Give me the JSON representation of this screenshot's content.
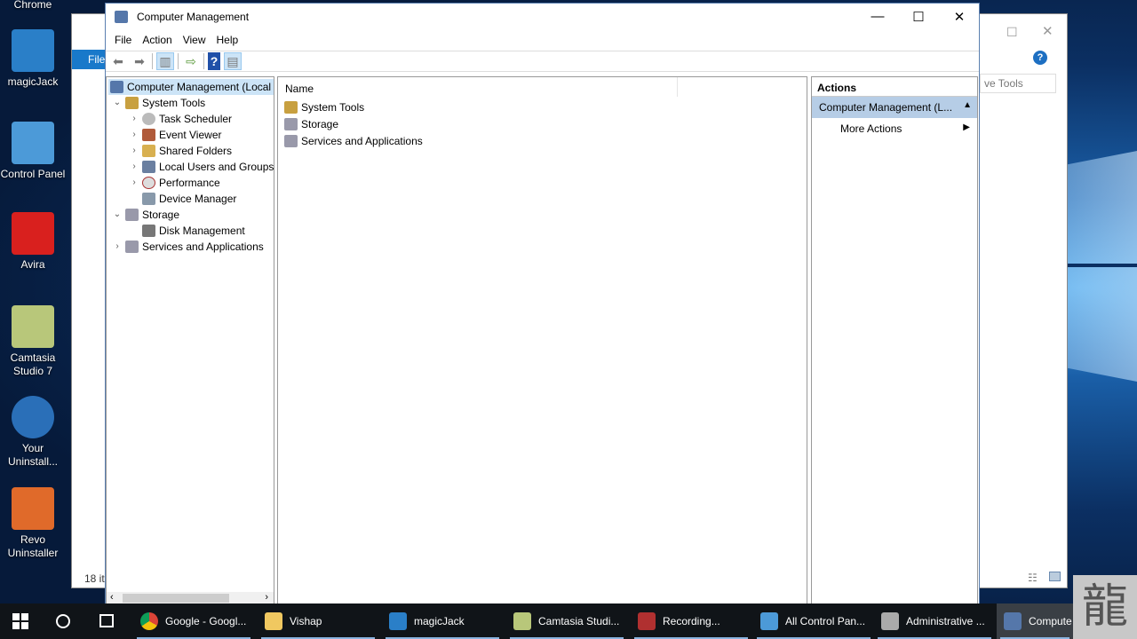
{
  "desktop": {
    "icons": [
      {
        "label": "Chrome"
      },
      {
        "label": "magicJack"
      },
      {
        "label": "Control Panel"
      },
      {
        "label": "Avira"
      },
      {
        "label": "Camtasia Studio 7"
      },
      {
        "label": "Your Uninstall..."
      },
      {
        "label": "Revo Uninstaller"
      }
    ]
  },
  "bg_window": {
    "ribbon_tab": "File",
    "search_placeholder": "ve Tools",
    "status": "18 it"
  },
  "window": {
    "title": "Computer Management",
    "controls": {
      "minimize": "—",
      "maximize": "☐",
      "close": "✕"
    }
  },
  "menu": [
    "File",
    "Action",
    "View",
    "Help"
  ],
  "tree": {
    "root": "Computer Management (Local",
    "items": [
      {
        "label": "System Tools"
      },
      {
        "label": "Task Scheduler"
      },
      {
        "label": "Event Viewer"
      },
      {
        "label": "Shared Folders"
      },
      {
        "label": "Local Users and Groups"
      },
      {
        "label": "Performance"
      },
      {
        "label": "Device Manager"
      },
      {
        "label": "Storage"
      },
      {
        "label": "Disk Management"
      },
      {
        "label": "Services and Applications"
      }
    ]
  },
  "list": {
    "column": "Name",
    "items": [
      "System Tools",
      "Storage",
      "Services and Applications"
    ]
  },
  "actions": {
    "header": "Actions",
    "section": "Computer Management (L...",
    "more": "More Actions"
  },
  "taskbar": {
    "items": [
      "Google - Googl...",
      "Vishap",
      "magicJack",
      "Camtasia Studi...",
      "Recording...",
      "All Control Pan...",
      "Administrative ...",
      "Compute"
    ]
  },
  "colors": {
    "accent": "#0078d7",
    "selection": "#cce4f7",
    "actions_section": "#b6cde6"
  }
}
